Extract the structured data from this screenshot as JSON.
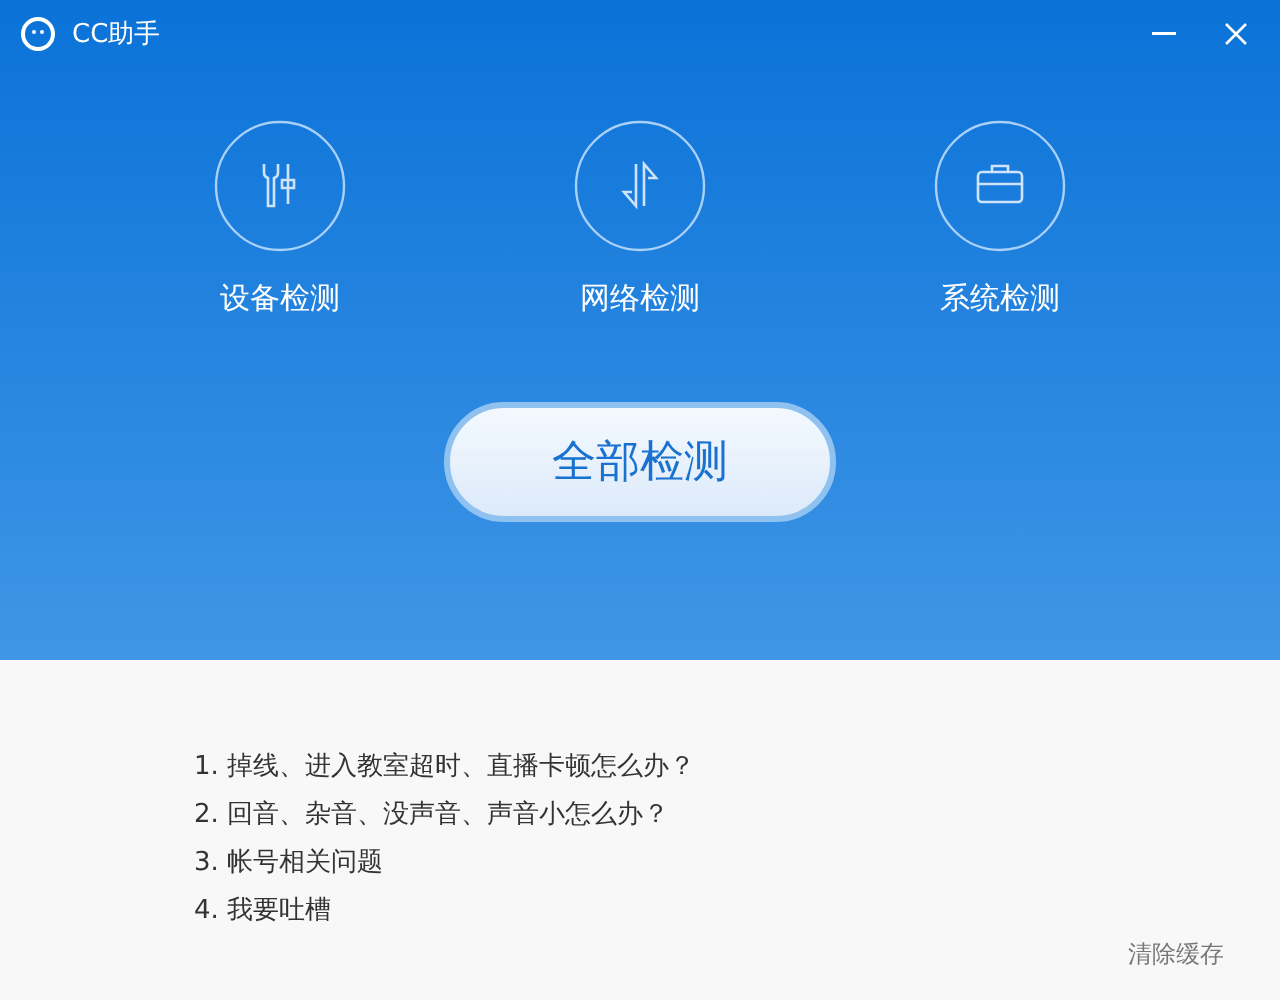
{
  "window": {
    "title": "CC助手"
  },
  "checks": [
    {
      "kind": "device",
      "label": "设备检测"
    },
    {
      "kind": "network",
      "label": "网络检测"
    },
    {
      "kind": "system",
      "label": "系统检测"
    }
  ],
  "main_button": "全部检测",
  "faq": [
    "1. 掉线、进入教室超时、直播卡顿怎么办？",
    "2. 回音、杂音、没声音、声音小怎么办？",
    "3. 帐号相关问题",
    "4. 我要吐槽"
  ],
  "footer_link": "清除缓存"
}
